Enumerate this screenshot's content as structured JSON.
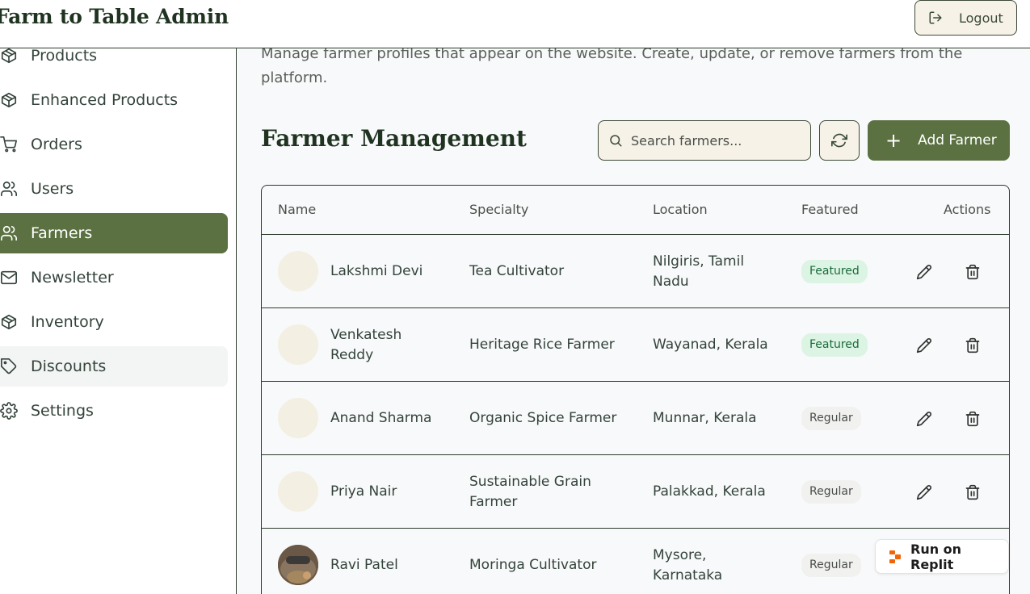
{
  "header": {
    "brand": "Farm to Table Admin",
    "logout_label": "Logout"
  },
  "sidebar": {
    "items": [
      {
        "label": "Products",
        "icon": "box-icon"
      },
      {
        "label": "Enhanced Products",
        "icon": "box-icon"
      },
      {
        "label": "Orders",
        "icon": "cart-icon"
      },
      {
        "label": "Users",
        "icon": "users-icon"
      },
      {
        "label": "Farmers",
        "icon": "users-icon",
        "active": true
      },
      {
        "label": "Newsletter",
        "icon": "mail-icon"
      },
      {
        "label": "Inventory",
        "icon": "box-icon"
      },
      {
        "label": "Discounts",
        "icon": "tag-icon"
      },
      {
        "label": "Settings",
        "icon": "gear-icon"
      }
    ]
  },
  "main": {
    "intro": "Manage farmer profiles that appear on the website. Create, update, or remove farmers from the platform.",
    "title": "Farmer Management",
    "search_placeholder": "Search farmers...",
    "add_label": "Add Farmer"
  },
  "table": {
    "columns": [
      "Name",
      "Specialty",
      "Location",
      "Featured",
      "Actions"
    ],
    "rows": [
      {
        "name": "Lakshmi Devi",
        "specialty": "Tea Cultivator",
        "location": "Nilgiris, Tamil Nadu",
        "status": "Featured"
      },
      {
        "name": "Venkatesh Reddy",
        "specialty": "Heritage Rice Farmer",
        "location": "Wayanad, Kerala",
        "status": "Featured"
      },
      {
        "name": "Anand Sharma",
        "specialty": "Organic Spice Farmer",
        "location": "Munnar, Kerala",
        "status": "Regular"
      },
      {
        "name": "Priya Nair",
        "specialty": "Sustainable Grain Farmer",
        "location": "Palakkad, Kerala",
        "status": "Regular"
      },
      {
        "name": "Ravi Patel",
        "specialty": "Moringa Cultivator",
        "location": "Mysore, Karnataka",
        "status": "Regular"
      }
    ]
  },
  "replit": {
    "label": "Run on Replit"
  },
  "colors": {
    "primary": "#5b7142",
    "cream": "#f6f2e7",
    "title": "#1f3320",
    "featured_bg": "#dcf4e3",
    "featured_text": "#1b6a3c"
  }
}
